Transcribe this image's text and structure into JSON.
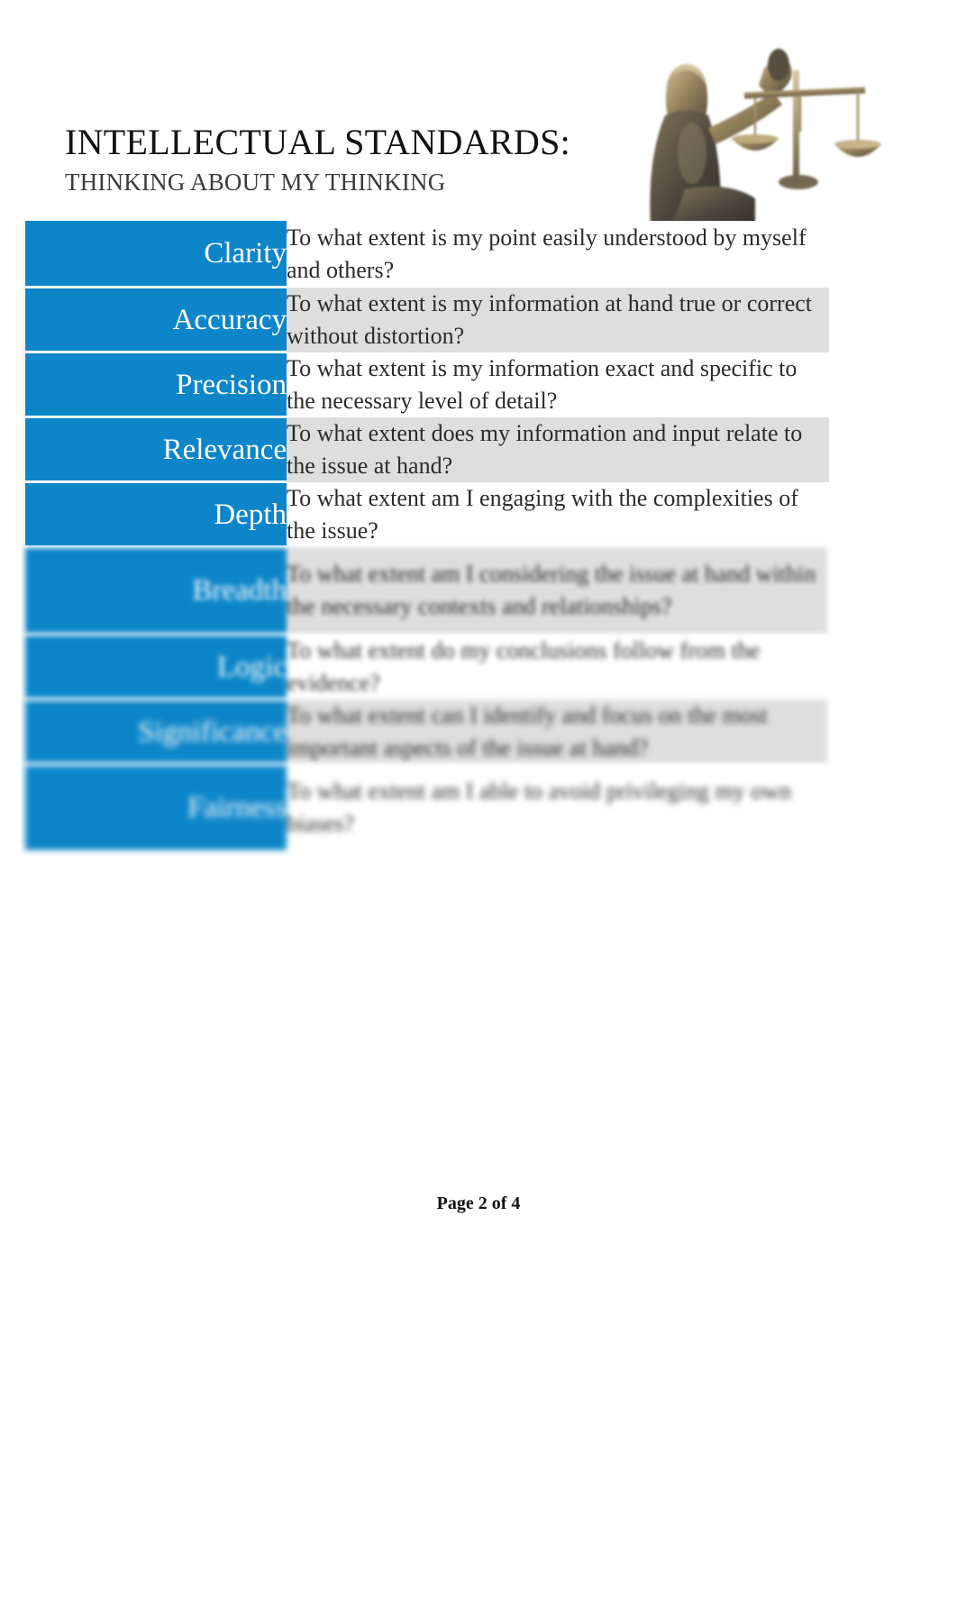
{
  "document": {
    "title": "INTELLECTUAL STANDARDS:",
    "subtitle": "THINKING ABOUT MY THINKING",
    "footer": "Page 2 of 4",
    "accent_color": "#0d86c9",
    "label_text_color": "#ffffff",
    "alt_row_color": "#dededf",
    "body_text_color": "#2b2b2b"
  },
  "artwork": {
    "name": "lady-justice-scales-image",
    "description": "Lady Justice statue holding balance scales"
  },
  "table": {
    "rows": [
      {
        "standard": "Clarity",
        "question": "To what extent is my point easily understood by myself and others?"
      },
      {
        "standard": "Accuracy",
        "question": "To what extent is my information at hand true or correct without distortion?"
      },
      {
        "standard": "Precision",
        "question": "To what extent is my information exact and specific to the necessary level of detail?"
      },
      {
        "standard": "Relevance",
        "question": "To what extent does my information and input relate to the issue at hand?"
      },
      {
        "standard": "Depth",
        "question": "To what extent am I engaging with the complexities of the issue?"
      },
      {
        "standard": "Breadth",
        "question": "To what extent am I considering the issue at hand within the necessary contexts and relationships?"
      },
      {
        "standard": "Logic",
        "question": "To what extent do my conclusions follow from the evidence?"
      },
      {
        "standard": "Significance",
        "question": "To what extent can I identify and focus on the most important aspects of the issue at hand?"
      },
      {
        "standard": "Fairness",
        "question": "To what extent am I able to avoid privileging my own biases?"
      }
    ]
  }
}
